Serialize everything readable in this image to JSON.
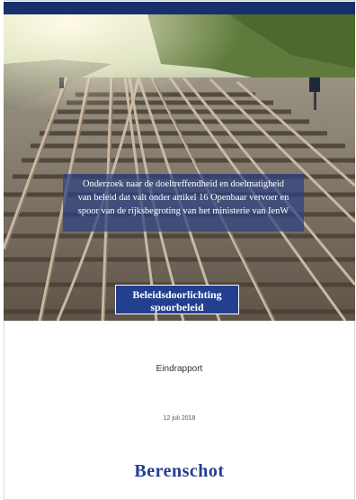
{
  "cover": {
    "title_lines": [
      "Onderzoek naar de doeltreffendheid en doelmatigheid",
      "van beleid dat valt onder artikel 16 Openbaar vervoer en",
      "spoor van de rijksbegroting van het ministerie van IenW"
    ],
    "label_lines": [
      "Beleidsdoorlichting",
      "spoorbeleid"
    ],
    "subtitle": "Eindrapport",
    "date": "12 juli 2018",
    "brand": "Berenschot"
  },
  "colors": {
    "brand_blue": "#233f8f",
    "top_bar": "#17306b"
  }
}
